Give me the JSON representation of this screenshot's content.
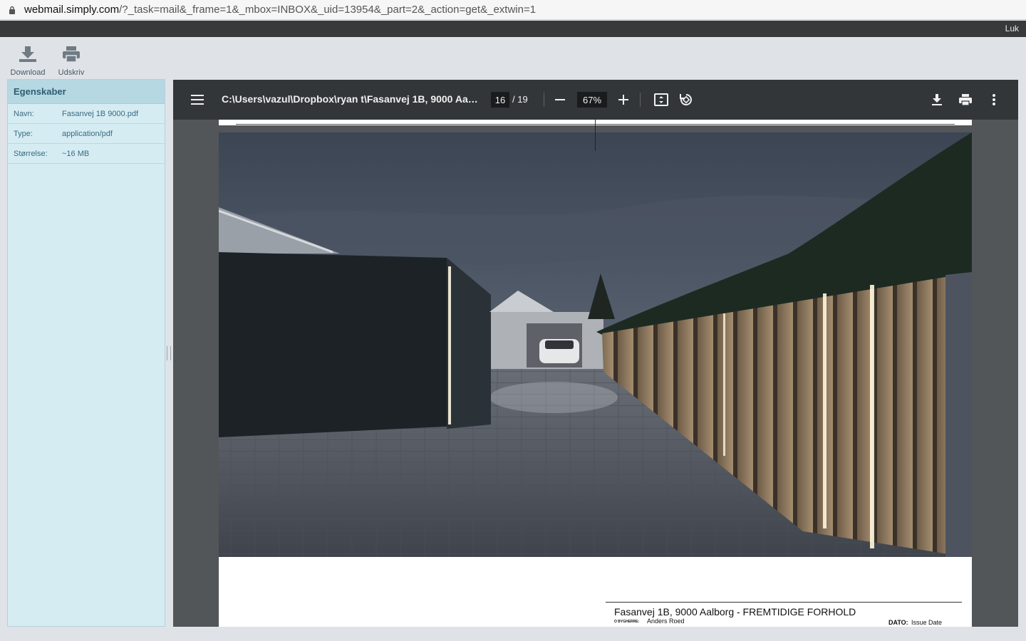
{
  "browser": {
    "url_host": "webmail.simply.com",
    "url_path": "/?_task=mail&_frame=1&_mbox=INBOX&_uid=13954&_part=2&_action=get&_extwin=1"
  },
  "topbar": {
    "close_label": "Luk"
  },
  "toolbar": {
    "download_label": "Download",
    "print_label": "Udskriv"
  },
  "properties": {
    "title": "Egenskaber",
    "rows": [
      {
        "key": "Navn:",
        "value": "Fasanvej 1B 9000.pdf"
      },
      {
        "key": "Type:",
        "value": "application/pdf"
      },
      {
        "key": "Størrelse:",
        "value": "~16 MB"
      }
    ]
  },
  "pdf_viewer": {
    "title": "C:\\Users\\vazul\\Dropbox\\ryan t\\Fasanvej 1B, 9000 Aalb...",
    "current_page": "16",
    "total_pages": "/ 19",
    "zoom": "67%",
    "icons": {
      "menu": "menu-icon",
      "zoom_out": "minus-icon",
      "zoom_in": "plus-icon",
      "fit": "fit-page-icon",
      "rotate": "rotate-icon",
      "download": "download-icon",
      "print": "print-icon",
      "more": "more-vert-icon"
    }
  },
  "document": {
    "caption_title": "Fasanvej 1B, 9000 Aalborg - FREMTIDIGE FORHOLD",
    "owner_label": "O BYGHERRE:",
    "owner": "Anders Roed",
    "date_label": "DATO:",
    "date_value": "Issue Date"
  },
  "colors": {
    "panel_bg": "#d6ecf3",
    "panel_header": "#b5d8e2",
    "viewer_bg": "#525659",
    "viewer_toolbar": "#323639"
  }
}
